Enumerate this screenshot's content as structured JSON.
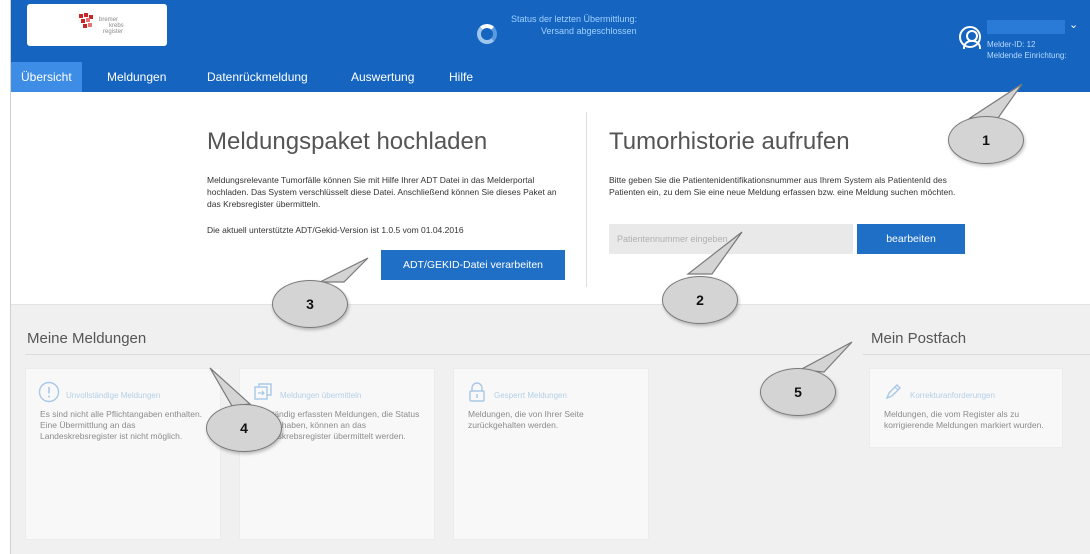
{
  "header": {
    "logo": {
      "line1": "bremer",
      "line2": "krebs",
      "line3": "register"
    },
    "status": {
      "line1": "Status der letzten Übermittlung:",
      "line2": "Versand abgeschlossen"
    },
    "user": {
      "melder_id": "Melder-ID: 12",
      "einrichtung": "Meldende Einrichtung:"
    }
  },
  "nav": {
    "items": [
      {
        "label": "Übersicht",
        "active": true
      },
      {
        "label": "Meldungen",
        "active": false
      },
      {
        "label": "Datenrückmeldung",
        "active": false
      },
      {
        "label": "Auswertung",
        "active": false
      },
      {
        "label": "Hilfe",
        "active": false
      }
    ]
  },
  "upload": {
    "title": "Meldungspaket hochladen",
    "text": "Meldungsrelevante Tumorfälle können Sie mit Hilfe Ihrer ADT Datei in das Melderportal hochladen. Das System verschlüsselt diese Datei. Anschließend können Sie dieses Paket an das Krebsregister übermitteln.",
    "version": "Die aktuell unterstützte ADT/Gekid-Version ist 1.0.5 vom 01.04.2016",
    "button": "ADT/GEKID-Datei verarbeiten"
  },
  "history": {
    "title": "Tumorhistorie aufrufen",
    "text": "Bitte geben Sie die Patientenidentifikationsnummer aus Ihrem System als PatientenId des Patienten ein, zu dem Sie eine neue Meldung erfassen bzw. eine Meldung suchen möchten.",
    "placeholder": "Patientennummer eingeben",
    "button": "bearbeiten"
  },
  "meine_meldungen": {
    "title": "Meine Meldungen",
    "cards": [
      {
        "title": "Unvollständige Meldungen",
        "text": "Es sind nicht alle Pflichtangaben enthalten. Eine Übermittlung an das Landeskrebsregister ist nicht möglich.",
        "icon": "exclamation-circle-icon"
      },
      {
        "title": "Meldungen übermitteln",
        "text": "Vollständig erfassten Meldungen, die Status 'Gültig' haben, können an das Landeskrebsregister übermittelt werden.",
        "icon": "send-documents-icon"
      },
      {
        "title": "Gesperrt Meldungen",
        "text": "Meldungen, die von Ihrer Seite zurückgehalten werden.",
        "icon": "lock-icon"
      }
    ]
  },
  "postfach": {
    "title": "Mein Postfach",
    "card": {
      "title": "Korrekturanforderungen",
      "text": "Meldungen, die vom Register als zu korrigierende Meldungen markiert wurden.",
      "icon": "pencil-icon"
    }
  },
  "callouts": [
    "1",
    "2",
    "3",
    "4",
    "5"
  ],
  "colors": {
    "header": "#1565c0",
    "active_tab": "#3d8de6",
    "button": "#1f6fc7"
  }
}
